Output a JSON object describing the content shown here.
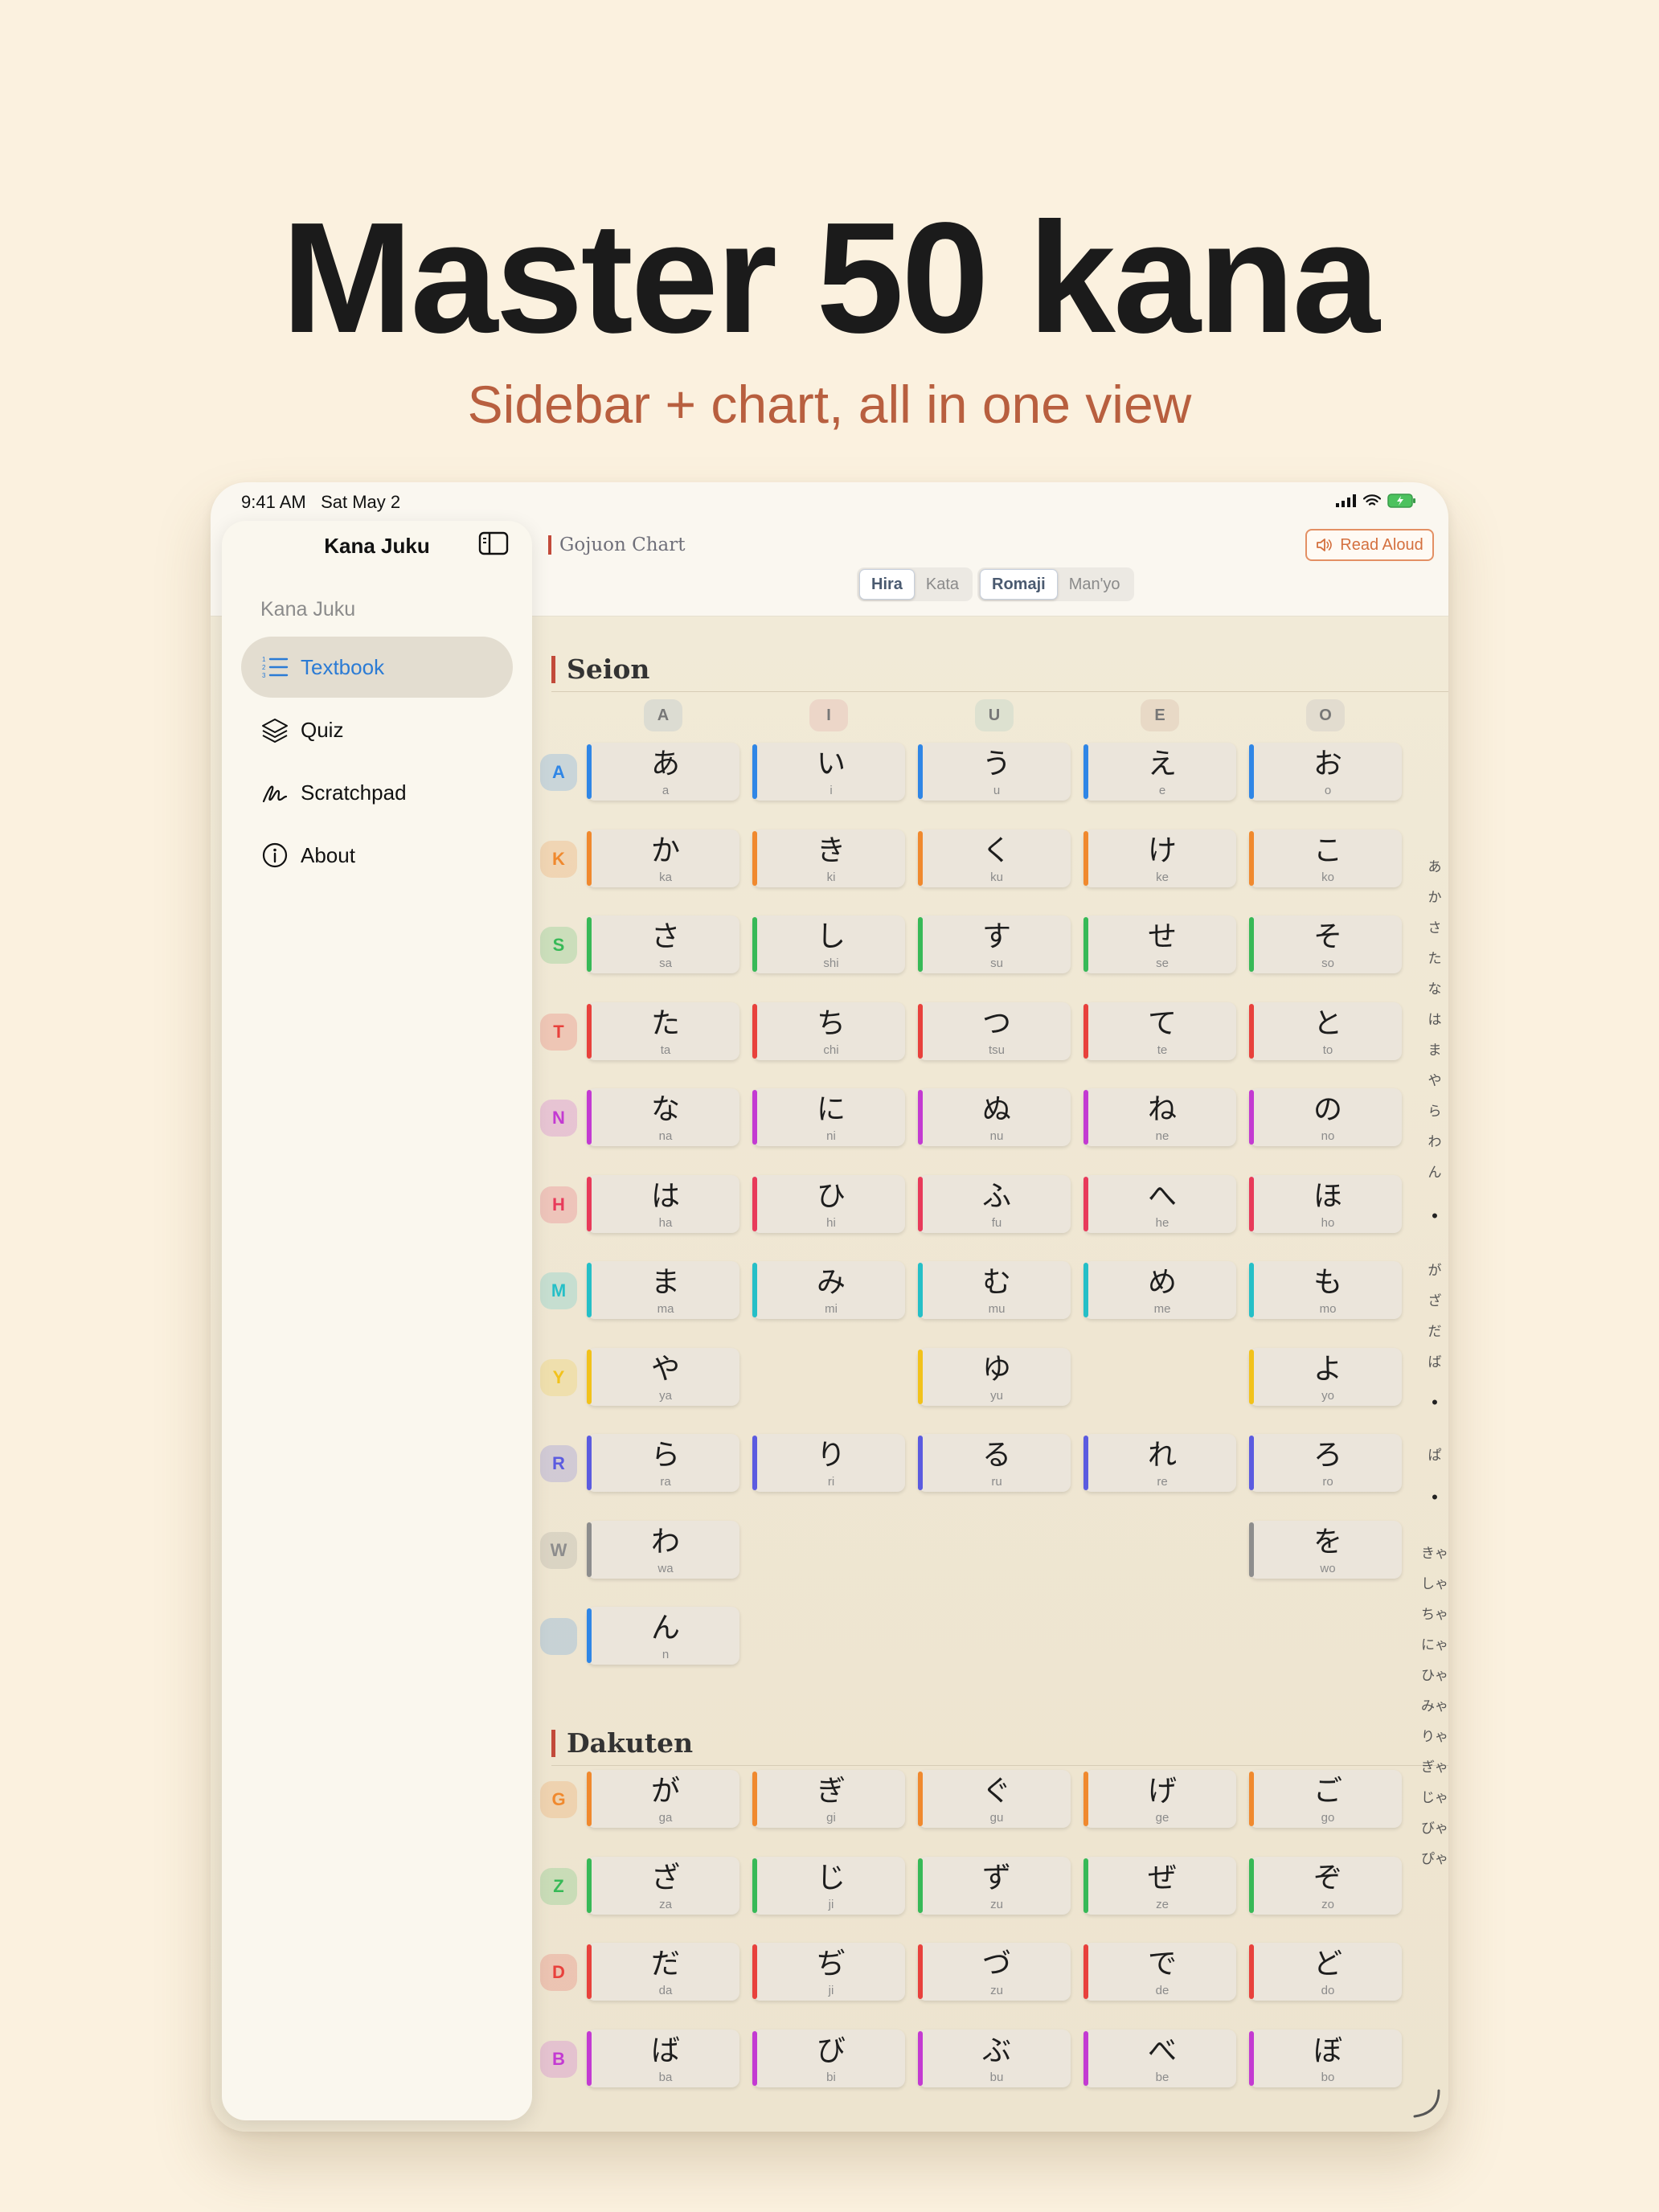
{
  "hero": {
    "headline": "Master 50 kana",
    "subline": "Sidebar + chart, all in one view"
  },
  "status": {
    "time": "9:41 AM",
    "date": "Sat May 2"
  },
  "sidebar": {
    "title": "Kana Juku",
    "section": "Kana Juku",
    "items": [
      {
        "label": "Textbook",
        "icon": "list-numbered-icon",
        "active": true
      },
      {
        "label": "Quiz",
        "icon": "layers-icon",
        "active": false
      },
      {
        "label": "Scratchpad",
        "icon": "scribble-icon",
        "active": false
      },
      {
        "label": "About",
        "icon": "info-circle-icon",
        "active": false
      }
    ]
  },
  "header": {
    "title": "Gojuon Chart",
    "read_aloud": "Read Aloud",
    "script_toggle": [
      {
        "label": "Hira",
        "selected": true
      },
      {
        "label": "Kata",
        "selected": false
      }
    ],
    "reading_toggle": [
      {
        "label": "Romaji",
        "selected": true
      },
      {
        "label": "Man'yo",
        "selected": false
      }
    ]
  },
  "colors": {
    "accent": "#2b7bd5",
    "brand": "#c24a3a",
    "read_aloud": "#d4703f"
  },
  "seion": {
    "title": "Seion",
    "columns": [
      "A",
      "I",
      "U",
      "E",
      "O"
    ],
    "rows": [
      {
        "label": "A",
        "color": "#2f86e6",
        "cells": [
          [
            "あ",
            "a"
          ],
          [
            "い",
            "i"
          ],
          [
            "う",
            "u"
          ],
          [
            "え",
            "e"
          ],
          [
            "お",
            "o"
          ]
        ]
      },
      {
        "label": "K",
        "color": "#f0892e",
        "cells": [
          [
            "か",
            "ka"
          ],
          [
            "き",
            "ki"
          ],
          [
            "く",
            "ku"
          ],
          [
            "け",
            "ke"
          ],
          [
            "こ",
            "ko"
          ]
        ]
      },
      {
        "label": "S",
        "color": "#37b957",
        "cells": [
          [
            "さ",
            "sa"
          ],
          [
            "し",
            "shi"
          ],
          [
            "す",
            "su"
          ],
          [
            "せ",
            "se"
          ],
          [
            "そ",
            "so"
          ]
        ]
      },
      {
        "label": "T",
        "color": "#e8413c",
        "cells": [
          [
            "た",
            "ta"
          ],
          [
            "ち",
            "chi"
          ],
          [
            "つ",
            "tsu"
          ],
          [
            "て",
            "te"
          ],
          [
            "と",
            "to"
          ]
        ]
      },
      {
        "label": "N",
        "color": "#c33ad2",
        "cells": [
          [
            "な",
            "na"
          ],
          [
            "に",
            "ni"
          ],
          [
            "ぬ",
            "nu"
          ],
          [
            "ね",
            "ne"
          ],
          [
            "の",
            "no"
          ]
        ]
      },
      {
        "label": "H",
        "color": "#e83a5a",
        "cells": [
          [
            "は",
            "ha"
          ],
          [
            "ひ",
            "hi"
          ],
          [
            "ふ",
            "fu"
          ],
          [
            "へ",
            "he"
          ],
          [
            "ほ",
            "ho"
          ]
        ]
      },
      {
        "label": "M",
        "color": "#25bfc7",
        "cells": [
          [
            "ま",
            "ma"
          ],
          [
            "み",
            "mi"
          ],
          [
            "む",
            "mu"
          ],
          [
            "め",
            "me"
          ],
          [
            "も",
            "mo"
          ]
        ]
      },
      {
        "label": "Y",
        "color": "#f2c21b",
        "cells": [
          [
            "や",
            "ya"
          ],
          null,
          [
            "ゆ",
            "yu"
          ],
          null,
          [
            "よ",
            "yo"
          ]
        ]
      },
      {
        "label": "R",
        "color": "#5b5be0",
        "cells": [
          [
            "ら",
            "ra"
          ],
          [
            "り",
            "ri"
          ],
          [
            "る",
            "ru"
          ],
          [
            "れ",
            "re"
          ],
          [
            "ろ",
            "ro"
          ]
        ]
      },
      {
        "label": "W",
        "color": "#8d8d8d",
        "cells": [
          [
            "わ",
            "wa"
          ],
          null,
          null,
          null,
          [
            "を",
            "wo"
          ]
        ]
      },
      {
        "label": "",
        "color": "#2f86e6",
        "cells": [
          [
            "ん",
            "n"
          ],
          null,
          null,
          null,
          null
        ]
      }
    ]
  },
  "dakuten": {
    "title": "Dakuten",
    "rows": [
      {
        "label": "G",
        "color": "#f0892e",
        "cells": [
          [
            "が",
            "ga"
          ],
          [
            "ぎ",
            "gi"
          ],
          [
            "ぐ",
            "gu"
          ],
          [
            "げ",
            "ge"
          ],
          [
            "ご",
            "go"
          ]
        ]
      },
      {
        "label": "Z",
        "color": "#37b957",
        "cells": [
          [
            "ざ",
            "za"
          ],
          [
            "じ",
            "ji"
          ],
          [
            "ず",
            "zu"
          ],
          [
            "ぜ",
            "ze"
          ],
          [
            "ぞ",
            "zo"
          ]
        ]
      },
      {
        "label": "D",
        "color": "#e8413c",
        "cells": [
          [
            "だ",
            "da"
          ],
          [
            "ぢ",
            "ji"
          ],
          [
            "づ",
            "zu"
          ],
          [
            "で",
            "de"
          ],
          [
            "ど",
            "do"
          ]
        ]
      },
      {
        "label": "B",
        "color": "#c33ad2",
        "cells": [
          [
            "ば",
            "ba"
          ],
          [
            "び",
            "bi"
          ],
          [
            "ぶ",
            "bu"
          ],
          [
            "べ",
            "be"
          ],
          [
            "ぼ",
            "bo"
          ]
        ]
      }
    ]
  },
  "index": [
    "あ",
    "か",
    "さ",
    "た",
    "な",
    "は",
    "ま",
    "や",
    "ら",
    "わ",
    "ん",
    "•",
    "が",
    "ざ",
    "だ",
    "ば",
    "•",
    "ぱ",
    "•",
    "きゃ",
    "しゃ",
    "ちゃ",
    "にゃ",
    "ひゃ",
    "みゃ",
    "りゃ",
    "ぎゃ",
    "じゃ",
    "びゃ",
    "ぴゃ"
  ]
}
